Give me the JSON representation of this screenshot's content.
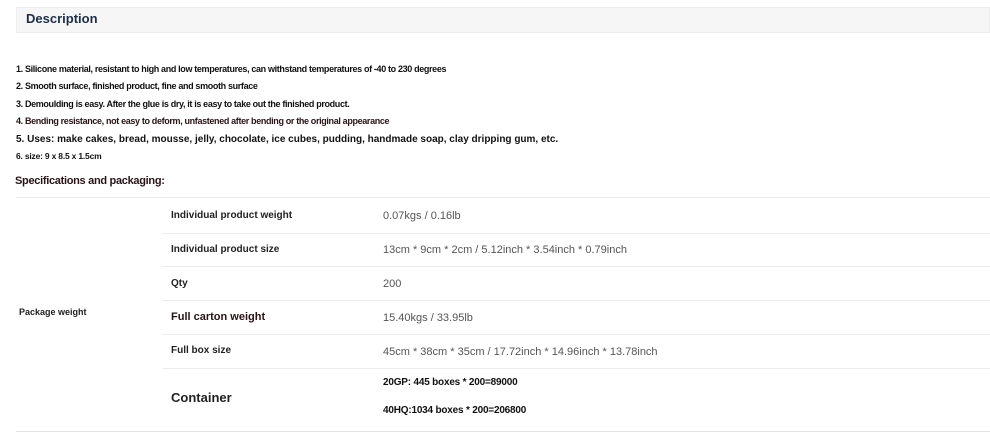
{
  "description": {
    "title": "Description",
    "features": [
      "1. Silicone material, resistant to high and low temperatures, can withstand temperatures of -40 to 230 degrees",
      "2. Smooth surface, finished product, fine and smooth surface",
      "3. Demoulding is easy. After the glue is dry, it is easy to take out the finished product.",
      "4. Bending resistance, not easy to deform, unfastened after bending or the original appearance",
      "5. Uses: make cakes, bread, mousse, jelly, chocolate, ice cubes, pudding, handmade soap, clay dripping gum, etc.",
      "6. size: 9 x 8.5 x 1.5cm"
    ]
  },
  "specifications": {
    "heading": "Specifications and packaging:",
    "group_label": "Package weight",
    "rows": [
      {
        "label": "Individual product weight",
        "value": "0.07kgs / 0.16lb"
      },
      {
        "label": "Individual product size",
        "value": "13cm * 9cm * 2cm / 5.12inch * 3.54inch * 0.79inch"
      },
      {
        "label": "Qty",
        "value": "200"
      },
      {
        "label": "Full carton weight",
        "value": "15.40kgs / 33.95lb"
      },
      {
        "label": "Full box size",
        "value": "45cm * 38cm * 35cm / 17.72inch * 14.96inch * 13.78inch"
      }
    ],
    "container": {
      "label": "Container",
      "values": [
        "20GP: 445 boxes * 200=89000",
        "40HQ:1034 boxes * 200=206800"
      ]
    }
  }
}
